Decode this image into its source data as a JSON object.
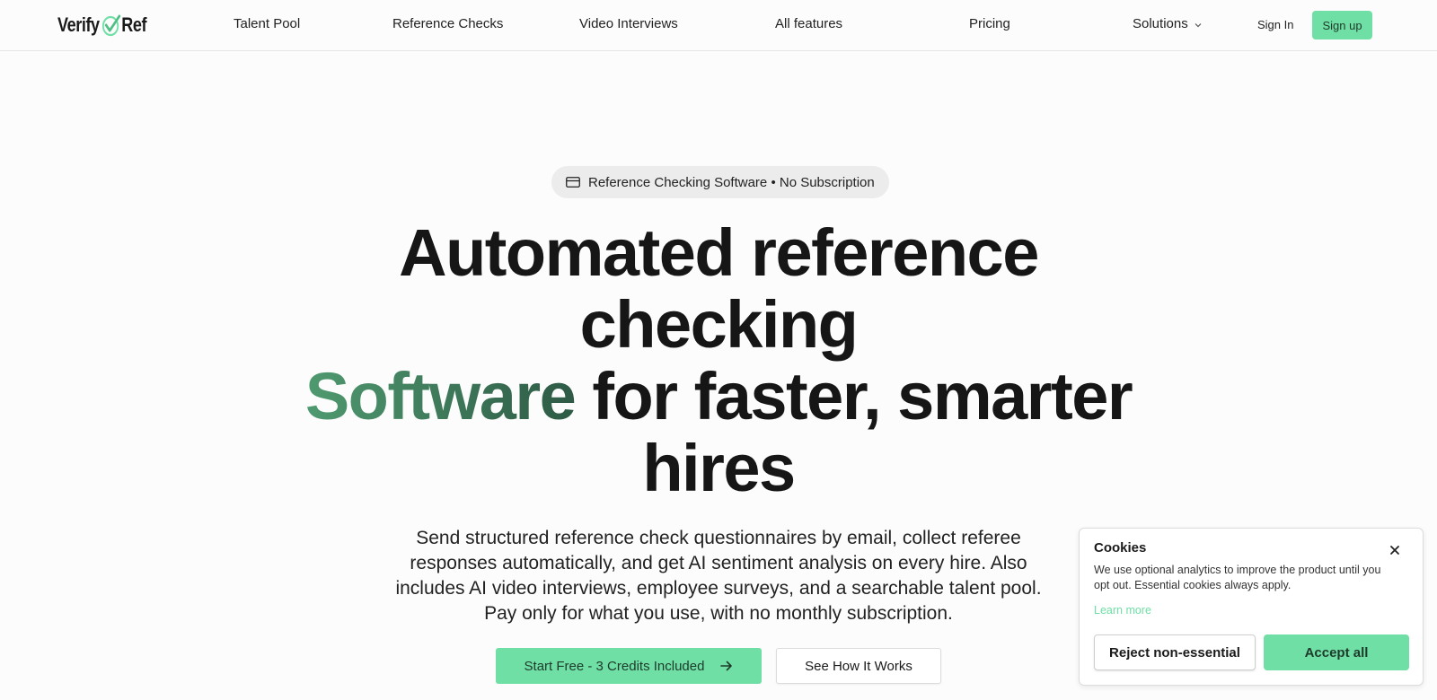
{
  "brand": {
    "logo_text_left": "Verify",
    "logo_text_right": "Ref",
    "accent_color": "#6fdfa5",
    "headline_accent_colors": [
      "#4f9a70",
      "#2e5a45"
    ]
  },
  "nav": {
    "links": [
      "Talent Pool",
      "Reference Checks",
      "Video Interviews",
      "All features",
      "Pricing"
    ],
    "solutions_label": "Solutions",
    "signin_label": "Sign In",
    "signup_label": "Sign up"
  },
  "hero": {
    "pill_icon": "credit-card-icon",
    "pill_text": "Reference Checking Software • No Subscription",
    "headline_line1": "Automated reference",
    "headline_line2": "checking",
    "headline_accent": "Software",
    "headline_line3_rest": " for faster, smarter",
    "headline_line4": "hires",
    "subtext": "Send structured reference check questionnaires by email, collect referee responses automatically, and get AI sentiment analysis on every hire. Also includes AI video interviews, employee surveys, and a searchable talent pool. Pay only for what you use, with no monthly subscription.",
    "cta_primary": "Start Free - 3 Credits Included",
    "cta_secondary": "See How It Works"
  },
  "cookie": {
    "title": "Cookies",
    "text": "We use optional analytics to improve the product until you opt out. Essential cookies always apply.",
    "learn_more": "Learn more",
    "reject_label": "Reject non-essential",
    "accept_label": "Accept all"
  }
}
